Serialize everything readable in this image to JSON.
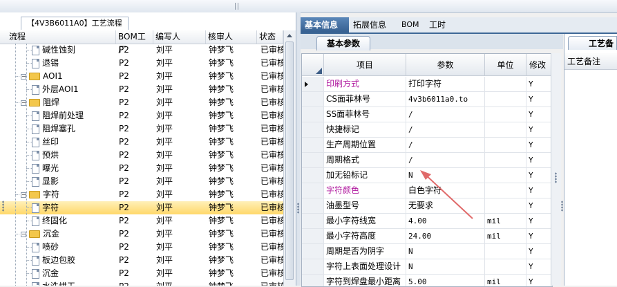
{
  "left_panel": {
    "tab_label": "【4V3B6011A0】工艺流程",
    "columns": [
      "流程",
      "BOM工厂",
      "编写人",
      "核审人",
      "状态"
    ],
    "rows": [
      {
        "name": "碱性蚀刻",
        "level": 2,
        "kind": "file",
        "bom": "P2",
        "writer": "刘平",
        "reviewer": "钟梦飞",
        "status": "已审核"
      },
      {
        "name": "退锡",
        "level": 2,
        "kind": "file",
        "bom": "P2",
        "writer": "刘平",
        "reviewer": "钟梦飞",
        "status": "已审核"
      },
      {
        "name": "AOI1",
        "level": 1,
        "kind": "folder",
        "bom": "P2",
        "writer": "刘平",
        "reviewer": "钟梦飞",
        "status": "已审核"
      },
      {
        "name": "外层AOI1",
        "level": 2,
        "kind": "file",
        "bom": "P2",
        "writer": "刘平",
        "reviewer": "钟梦飞",
        "status": "已审核"
      },
      {
        "name": "阻焊",
        "level": 1,
        "kind": "folder",
        "bom": "P2",
        "writer": "刘平",
        "reviewer": "钟梦飞",
        "status": "已审核"
      },
      {
        "name": "阻焊前处理",
        "level": 2,
        "kind": "file",
        "bom": "P2",
        "writer": "刘平",
        "reviewer": "钟梦飞",
        "status": "已审核"
      },
      {
        "name": "阻焊塞孔",
        "level": 2,
        "kind": "file",
        "bom": "P2",
        "writer": "刘平",
        "reviewer": "钟梦飞",
        "status": "已审核"
      },
      {
        "name": "丝印",
        "level": 2,
        "kind": "file",
        "bom": "P2",
        "writer": "刘平",
        "reviewer": "钟梦飞",
        "status": "已审核"
      },
      {
        "name": "预烘",
        "level": 2,
        "kind": "file",
        "bom": "P2",
        "writer": "刘平",
        "reviewer": "钟梦飞",
        "status": "已审核"
      },
      {
        "name": "曝光",
        "level": 2,
        "kind": "file",
        "bom": "P2",
        "writer": "刘平",
        "reviewer": "钟梦飞",
        "status": "已审核"
      },
      {
        "name": "显影",
        "level": 2,
        "kind": "file",
        "bom": "P2",
        "writer": "刘平",
        "reviewer": "钟梦飞",
        "status": "已审核"
      },
      {
        "name": "字符",
        "level": 1,
        "kind": "folder",
        "bom": "P2",
        "writer": "刘平",
        "reviewer": "钟梦飞",
        "status": "已审核"
      },
      {
        "name": "字符",
        "level": 2,
        "kind": "file",
        "bom": "P2",
        "writer": "刘平",
        "reviewer": "钟梦飞",
        "status": "已审核",
        "selected": true
      },
      {
        "name": "终固化",
        "level": 2,
        "kind": "file",
        "bom": "P2",
        "writer": "刘平",
        "reviewer": "钟梦飞",
        "status": "已审核"
      },
      {
        "name": "沉金",
        "level": 1,
        "kind": "folder",
        "bom": "P2",
        "writer": "刘平",
        "reviewer": "钟梦飞",
        "status": "已审核"
      },
      {
        "name": "喷砂",
        "level": 2,
        "kind": "file",
        "bom": "P2",
        "writer": "刘平",
        "reviewer": "钟梦飞",
        "status": "已审核"
      },
      {
        "name": "板边包胶",
        "level": 2,
        "kind": "file",
        "bom": "P2",
        "writer": "刘平",
        "reviewer": "钟梦飞",
        "status": "已审核"
      },
      {
        "name": "沉金",
        "level": 2,
        "kind": "file",
        "bom": "P2",
        "writer": "刘平",
        "reviewer": "钟梦飞",
        "status": "已审核"
      },
      {
        "name": "水洗烘干",
        "level": 2,
        "kind": "file",
        "bom": "P2",
        "writer": "刘平",
        "reviewer": "钟梦飞",
        "status": "已审核"
      }
    ]
  },
  "right_tabs": [
    "基本信息",
    "拓展信息",
    "BOM",
    "工时"
  ],
  "sub_tab": "基本参数",
  "grid": {
    "columns": [
      "项目",
      "参数",
      "单位",
      "修改"
    ],
    "rows": [
      {
        "item": "印刷方式",
        "param": "打印字符",
        "unit": "",
        "mod": "Y",
        "purple": true,
        "current": true
      },
      {
        "item": "CS面菲林号",
        "param": "4v3b6011a0.to",
        "unit": "",
        "mod": "Y"
      },
      {
        "item": "SS面菲林号",
        "param": "/",
        "unit": "",
        "mod": "Y"
      },
      {
        "item": "快捷标记",
        "param": "/",
        "unit": "",
        "mod": "Y"
      },
      {
        "item": "生产周期位置",
        "param": "/",
        "unit": "",
        "mod": "Y"
      },
      {
        "item": "周期格式",
        "param": "/",
        "unit": "",
        "mod": "Y"
      },
      {
        "item": "加无铅标记",
        "param": "N",
        "unit": "",
        "mod": "Y"
      },
      {
        "item": "字符颜色",
        "param": "白色字符",
        "unit": "",
        "mod": "Y",
        "purple": true
      },
      {
        "item": "油墨型号",
        "param": "无要求",
        "unit": "",
        "mod": "Y"
      },
      {
        "item": "最小字符线宽",
        "param": "4.00",
        "unit": "mil",
        "mod": "Y"
      },
      {
        "item": "最小字符高度",
        "param": "24.00",
        "unit": "mil",
        "mod": "Y"
      },
      {
        "item": "周期是否为阴字",
        "param": "N",
        "unit": "",
        "mod": "Y"
      },
      {
        "item": "字符上表面处理设计",
        "param": "N",
        "unit": "",
        "mod": "Y"
      },
      {
        "item": "字符到焊盘最小距离",
        "param": "5.00",
        "unit": "mil",
        "mod": "Y"
      }
    ]
  },
  "far_panel": {
    "tab_label": "工艺备",
    "header": "工艺备注"
  },
  "colors": {
    "accent": "#3d6796",
    "selected_row": "#ffd86a",
    "purple_text": "#b0199f",
    "annotation_arrow": "#e06a6a"
  }
}
